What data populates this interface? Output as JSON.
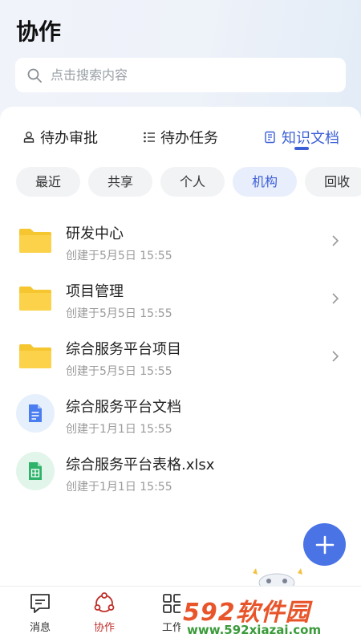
{
  "page": {
    "title": "协作"
  },
  "search": {
    "placeholder": "点击搜索内容"
  },
  "tabs": [
    {
      "label": "待办审批",
      "icon": "approval-person-icon"
    },
    {
      "label": "待办任务",
      "icon": "task-list-icon"
    },
    {
      "label": "知识文档",
      "icon": "document-icon",
      "active": true
    }
  ],
  "filters": [
    {
      "label": "最近"
    },
    {
      "label": "共享"
    },
    {
      "label": "个人"
    },
    {
      "label": "机构",
      "active": true
    },
    {
      "label": "回收"
    }
  ],
  "items": [
    {
      "name": "研发中心",
      "meta": "创建于5月5日 15:55",
      "type": "folder"
    },
    {
      "name": "项目管理",
      "meta": "创建于5月5日 15:55",
      "type": "folder"
    },
    {
      "name": "综合服务平台项目",
      "meta": "创建于5月5日 15:55",
      "type": "folder"
    },
    {
      "name": "综合服务平台文档",
      "meta": "创建于1月1日 15:55",
      "type": "doc"
    },
    {
      "name": "综合服务平台表格.xlsx",
      "meta": "创建于1月1日 15:55",
      "type": "sheet"
    }
  ],
  "bottom_nav": [
    {
      "label": "消息",
      "icon": "message-icon"
    },
    {
      "label": "协作",
      "icon": "collaboration-icon",
      "active": true
    },
    {
      "label": "工作",
      "icon": "grid-icon"
    }
  ],
  "watermark": {
    "logo": "592软件园",
    "url": "www.592xiazai.com"
  },
  "colors": {
    "accent": "#3b5fd6",
    "fab": "#4a74e6",
    "active_nav": "#c0302b",
    "folder": "#f6c631"
  }
}
